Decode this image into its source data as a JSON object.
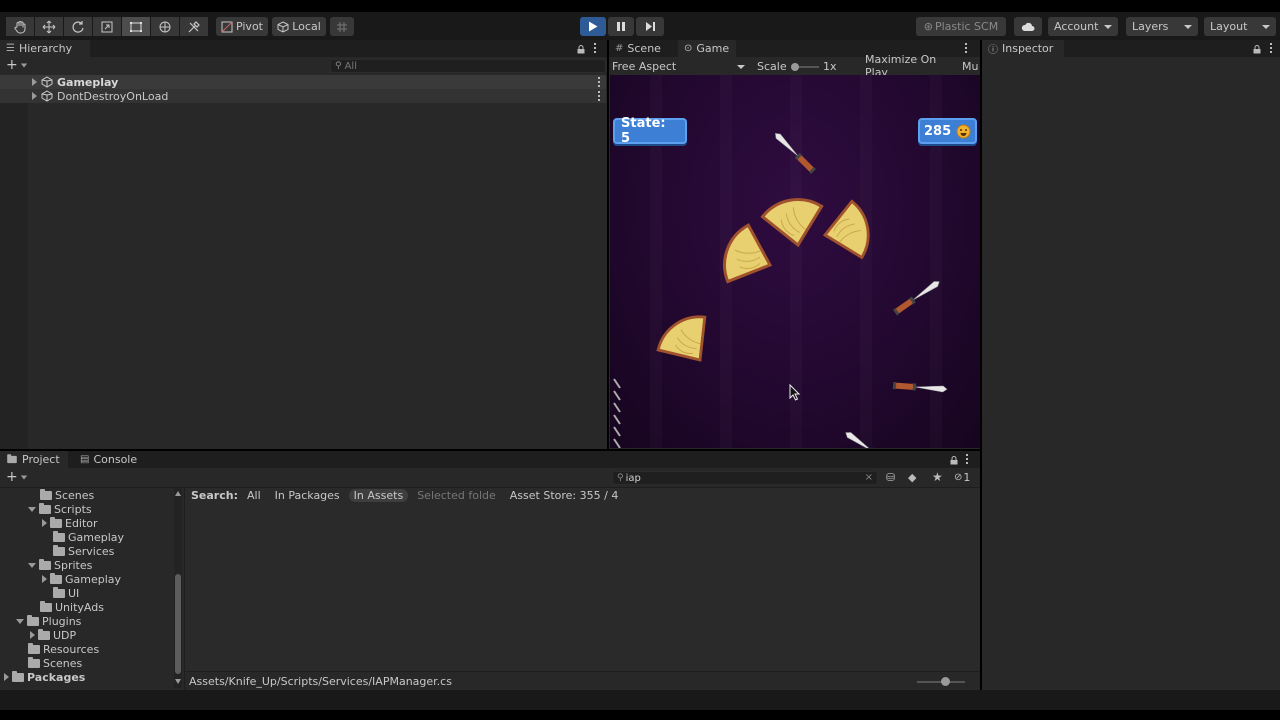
{
  "toolbar": {
    "pivot_label": "Pivot",
    "local_label": "Local",
    "plastic_label": "Plastic SCM",
    "account_label": "Account",
    "layers_label": "Layers",
    "layout_label": "Layout"
  },
  "hierarchy": {
    "tab_label": "Hierarchy",
    "search_placeholder": "All",
    "items": [
      {
        "label": "Gameplay"
      },
      {
        "label": "DontDestroyOnLoad"
      }
    ]
  },
  "game_view": {
    "scene_tab": "Scene",
    "game_tab": "Game",
    "aspect_label": "Free Aspect",
    "scale_label": "Scale",
    "scale_value": "1x",
    "maximize_label": "Maximize On Play",
    "mute_label": "Mu",
    "state_label": "State: 5",
    "score_label": "285"
  },
  "inspector": {
    "tab_label": "Inspector"
  },
  "project": {
    "project_tab": "Project",
    "console_tab": "Console",
    "search_value": "iap",
    "hidden_count": "1",
    "search_row": {
      "search_label": "Search:",
      "all": "All",
      "in_packages": "In Packages",
      "in_assets": "In Assets",
      "selected_folder": "Selected folde",
      "asset_store": "Asset Store: 355 / 4"
    },
    "tree": [
      {
        "label": "Scenes"
      },
      {
        "label": "Scripts"
      },
      {
        "label": "Editor"
      },
      {
        "label": "Gameplay"
      },
      {
        "label": "Services"
      },
      {
        "label": "Sprites"
      },
      {
        "label": "Gameplay"
      },
      {
        "label": "UI"
      },
      {
        "label": "UnityAds"
      },
      {
        "label": "Plugins"
      },
      {
        "label": "UDP"
      },
      {
        "label": "Resources"
      },
      {
        "label": "Scenes"
      },
      {
        "label": "Packages"
      }
    ],
    "path": "Assets/Knife_Up/Scripts/Services/IAPManager.cs"
  },
  "colors": {
    "accent": "#4c7ec9",
    "play_active": "#2e5a96",
    "pill_blue": "#3d7fd4",
    "game_bg": "#22082f",
    "wood": "#e8d070"
  }
}
